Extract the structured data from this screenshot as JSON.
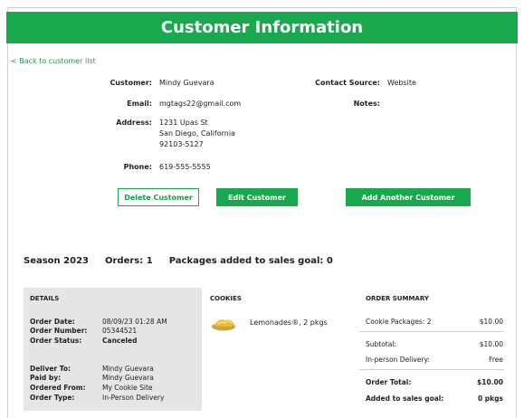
{
  "header": {
    "title": "Customer Information"
  },
  "nav": {
    "back_label": "< Back to customer list"
  },
  "customer": {
    "customer_label": "Customer:",
    "customer_value": "Mindy Guevara",
    "email_label": "Email:",
    "email_value": "mgtags22@gmail.com",
    "address_label": "Address:",
    "address_line1": "1231 Upas St",
    "address_line2": "San Diego, California",
    "address_line3": "92103-5127",
    "phone_label": "Phone:",
    "phone_value": "619-555-5555",
    "contact_source_label": "Contact Source:",
    "contact_source_value": "Website",
    "notes_label": "Notes:"
  },
  "actions": {
    "delete_label": "Delete Customer",
    "edit_label": "Edit Customer",
    "add_label": "Add Another Customer"
  },
  "season": {
    "season_label": "Season 2023",
    "orders_label": "Orders: 1",
    "packages_label": "Packages added to sales goal: 0"
  },
  "details": {
    "title": "DETAILS",
    "order_date_label": "Order Date:",
    "order_date_value": "08/09/23 01:28 AM",
    "order_number_label": "Order Number:",
    "order_number_value": "05344521",
    "order_status_label": "Order Status:",
    "order_status_value": "Canceled",
    "deliver_to_label": "Deliver To:",
    "deliver_to_value": "Mindy  Guevara",
    "paid_by_label": "Paid by:",
    "paid_by_value": "Mindy Guevara",
    "ordered_from_label": "Ordered From:",
    "ordered_from_value": "My Cookie Site",
    "order_type_label": "Order Type:",
    "order_type_value": "In-Person Delivery"
  },
  "cookies": {
    "title": "COOKIES",
    "item_icon": "lemonade-cookie-icon",
    "item_text": "Lemonades®, 2 pkgs"
  },
  "summary": {
    "title": "ORDER SUMMARY",
    "packages_label": "Cookie Packages: 2",
    "packages_value": "$10.00",
    "subtotal_label": "Subtotal:",
    "subtotal_value": "$10.00",
    "delivery_label": "In-person Delivery:",
    "delivery_value": "Free",
    "total_label": "Order Total:",
    "total_value": "$10.00",
    "goal_label": "Added to sales goal:",
    "goal_value": "0 pkgs"
  },
  "colors": {
    "brand_green": "#1aa84f",
    "panel_gray": "#e6e6e6"
  }
}
